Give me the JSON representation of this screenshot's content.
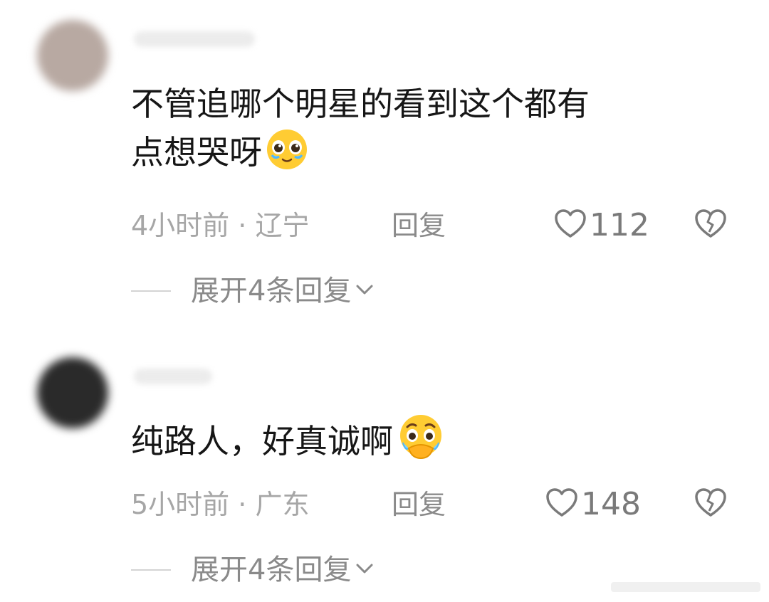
{
  "comments": [
    {
      "text": "不管追哪个明星的看到这个都有\n点想哭呀",
      "emoji": "pleading-face",
      "time": "4小时前",
      "separator": " · ",
      "location": "辽宁",
      "reply_label": "回复",
      "likes": "112",
      "expand_label": "展开4条回复",
      "avatar_color": "#b8a9a2"
    },
    {
      "text": "纯路人，好真诚啊",
      "emoji": "face-holding-back-tears",
      "time": "5小时前",
      "separator": " · ",
      "location": "广东",
      "reply_label": "回复",
      "likes": "148",
      "expand_label": "展开4条回复",
      "avatar_color": "#2a2a2a"
    }
  ],
  "colors": {
    "text": "#161616",
    "meta": "#a6a6a6",
    "action": "#8a8a8a",
    "emoji_yellow": "#ffcc33"
  }
}
